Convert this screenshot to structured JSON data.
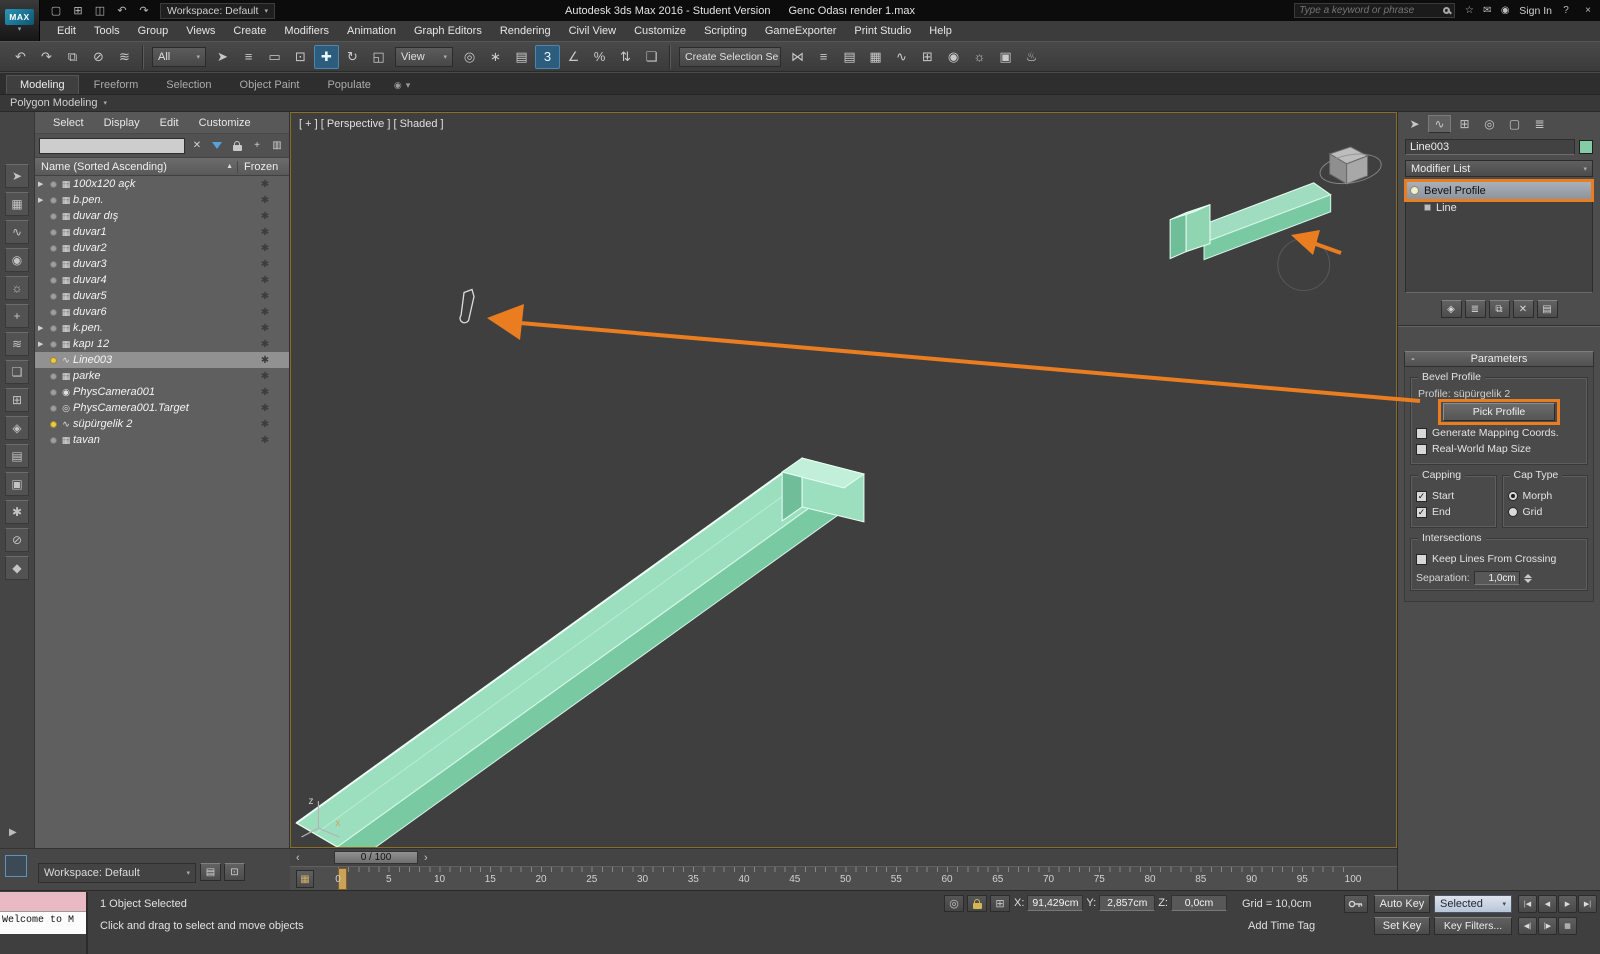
{
  "glyphs": {
    "arrow_down": "▾",
    "check": "✓",
    "minus": "-",
    "sort_asc": "▲",
    "slider_prev": "‹",
    "slider_next": "›",
    "expand": "▶"
  },
  "titlebar": {
    "app_icon": "MAX",
    "qat": [
      {
        "n": "new-scene-icon",
        "g": "▢"
      },
      {
        "n": "open-file-icon",
        "g": "⊞"
      },
      {
        "n": "save-file-icon",
        "g": "◫"
      },
      {
        "n": "undo-icon",
        "g": "↶"
      },
      {
        "n": "redo-icon",
        "g": "↷"
      }
    ],
    "workspace": "Workspace: Default",
    "title": "Autodesk 3ds Max 2016 - Student Version",
    "filename": "Genc Odası render 1.max",
    "search_placeholder": "Type a keyword or phrase",
    "info_icons": [
      {
        "n": "favorites-star-icon",
        "g": "☆"
      },
      {
        "n": "communication-icon",
        "g": "✉"
      },
      {
        "n": "user-icon",
        "g": "◉"
      }
    ],
    "sign_in": "Sign In",
    "help_icon": "?",
    "close_icon": "×"
  },
  "menubar": {
    "items": [
      "Edit",
      "Tools",
      "Group",
      "Views",
      "Create",
      "Modifiers",
      "Animation",
      "Graph Editors",
      "Rendering",
      "Civil View",
      "Customize",
      "Scripting",
      "GameExporter",
      "Print Studio",
      "Help"
    ]
  },
  "toolbar": {
    "seg1": [
      {
        "n": "undo-icon",
        "g": "↶"
      },
      {
        "n": "redo-icon",
        "g": "↷"
      },
      {
        "n": "select-and-link-icon",
        "g": "⧉"
      },
      {
        "n": "unlink-selection-icon",
        "g": "⊘"
      },
      {
        "n": "bind-to-space-warp-icon",
        "g": "≋"
      }
    ],
    "filter_value": "All",
    "seg2": [
      {
        "n": "select-object-icon",
        "g": "➤"
      },
      {
        "n": "select-by-name-icon",
        "g": "≡"
      },
      {
        "n": "rectangular-selection-icon",
        "g": "▭"
      },
      {
        "n": "window-crossing-icon",
        "g": "⊡"
      },
      {
        "n": "select-and-move-icon",
        "g": "✚",
        "cls": "active"
      },
      {
        "n": "select-and-rotate-icon",
        "g": "↻"
      },
      {
        "n": "select-and-scale-icon",
        "g": "◱"
      }
    ],
    "view_value": "View",
    "seg3": [
      {
        "n": "use-center-icon",
        "g": "◎"
      },
      {
        "n": "select-and-manipulate-icon",
        "g": "∗"
      },
      {
        "n": "keyboard-override-icon",
        "g": "▤"
      },
      {
        "n": "snaps-toggle-icon",
        "g": "3",
        "cls": "active"
      },
      {
        "n": "angle-snap-icon",
        "g": "∠"
      },
      {
        "n": "percent-snap-icon",
        "g": "%"
      },
      {
        "n": "spinner-snap-icon",
        "g": "⇅"
      },
      {
        "n": "edit-named-selections-icon",
        "g": "❏"
      }
    ],
    "selset_value": "Create Selection Se",
    "seg4": [
      {
        "n": "mirror-icon",
        "g": "⋈"
      },
      {
        "n": "align-icon",
        "g": "≡"
      },
      {
        "n": "layer-manager-icon",
        "g": "▤"
      },
      {
        "n": "ribbon-toggle-icon",
        "g": "▦"
      },
      {
        "n": "curve-editor-icon",
        "g": "∿"
      },
      {
        "n": "schematic-view-icon",
        "g": "⊞"
      },
      {
        "n": "material-editor-icon",
        "g": "◉"
      },
      {
        "n": "render-setup-icon",
        "g": "☼"
      },
      {
        "n": "rendered-frame-icon",
        "g": "▣"
      },
      {
        "n": "render-production-icon",
        "g": "♨"
      }
    ]
  },
  "ribbon": {
    "tabs": [
      {
        "label": "Modeling",
        "cls": "active"
      },
      {
        "label": "Freeform"
      },
      {
        "label": "Selection"
      },
      {
        "label": "Object Paint"
      },
      {
        "label": "Populate"
      }
    ],
    "extra": [
      {
        "n": "ribbon-options-icon",
        "g": "◉"
      },
      {
        "n": "ribbon-collapse-icon",
        "g": "▾"
      }
    ],
    "subtab": "Polygon Modeling"
  },
  "explorer": {
    "left_icons": [
      {
        "n": "select-filter-icon",
        "g": "➤"
      },
      {
        "n": "show-geometry-icon",
        "g": "▦"
      },
      {
        "n": "show-shapes-icon",
        "g": "∿"
      },
      {
        "n": "show-cameras-icon",
        "g": "◉"
      },
      {
        "n": "show-lights-icon",
        "g": "☼"
      },
      {
        "n": "show-helpers-icon",
        "g": "+"
      },
      {
        "n": "show-spacewarps-icon",
        "g": "≋"
      },
      {
        "n": "show-groups-icon",
        "g": "❏"
      },
      {
        "n": "show-xrefs-icon",
        "g": "⊞"
      },
      {
        "n": "show-materials-icon",
        "g": "◈"
      },
      {
        "n": "show-containers-icon",
        "g": "▤"
      },
      {
        "n": "show-bones-icon",
        "g": "▣"
      },
      {
        "n": "show-frozen-icon",
        "g": "✱"
      },
      {
        "n": "show-hidden-icon",
        "g": "⊘"
      },
      {
        "n": "pin-explorer-icon",
        "g": "◆"
      }
    ],
    "menus": [
      "Select",
      "Display",
      "Edit",
      "Customize"
    ],
    "header_name": "Name (Sorted Ascending)",
    "header_frozen": "Frozen",
    "items": [
      {
        "expand": "▶",
        "icon": "▦",
        "label": "100x120 açk",
        "frozen": "✱"
      },
      {
        "expand": "▶",
        "icon": "▦",
        "label": "b.pen.",
        "frozen": "✱"
      },
      {
        "icon": "▦",
        "label": "duvar dış",
        "frozen": "✱"
      },
      {
        "icon": "▦",
        "label": "duvar1",
        "frozen": "✱"
      },
      {
        "icon": "▦",
        "label": "duvar2",
        "frozen": "✱"
      },
      {
        "icon": "▦",
        "label": "duvar3",
        "frozen": "✱"
      },
      {
        "icon": "▦",
        "label": "duvar4",
        "frozen": "✱"
      },
      {
        "icon": "▦",
        "label": "duvar5",
        "frozen": "✱"
      },
      {
        "icon": "▦",
        "label": "duvar6",
        "frozen": "✱"
      },
      {
        "expand": "▶",
        "icon": "▦",
        "label": "k.pen.",
        "frozen": "✱"
      },
      {
        "expand": "▶",
        "icon": "▦",
        "label": "kapı 12",
        "frozen": "✱"
      },
      {
        "icon": "∿",
        "label": "Line003",
        "frozen": "✱",
        "cls": "selected bulb"
      },
      {
        "icon": "▦",
        "label": "parke",
        "frozen": "✱"
      },
      {
        "icon": "◉",
        "label": "PhysCamera001",
        "frozen": "✱"
      },
      {
        "icon": "◎",
        "label": "PhysCamera001.Target",
        "frozen": "✱"
      },
      {
        "icon": "∿",
        "label": "süpürgelik 2",
        "frozen": "✱",
        "cls": "bulb"
      },
      {
        "icon": "▦",
        "label": "tavan",
        "frozen": "✱"
      }
    ]
  },
  "viewport": {
    "label": "[ + ] [ Perspective ] [ Shaded ]",
    "axis_x": "x",
    "axis_z": "z"
  },
  "cpanel": {
    "tabs": [
      {
        "n": "create-tab-icon",
        "g": "➤"
      },
      {
        "n": "modify-tab-icon",
        "g": "∿",
        "cls": "active"
      },
      {
        "n": "hierarchy-tab-icon",
        "g": "⊞"
      },
      {
        "n": "motion-tab-icon",
        "g": "◎"
      },
      {
        "n": "display-tab-icon",
        "g": "▢"
      },
      {
        "n": "utilities-tab-icon",
        "g": "≣"
      }
    ],
    "object_name": "Line003",
    "modifier_list": "Modifier List",
    "stack": [
      {
        "label": "Bevel Profile",
        "cls": "selected annotated"
      },
      {
        "label": "Line",
        "cls": "child"
      }
    ],
    "stack_tools": [
      {
        "n": "pin-stack-icon",
        "g": "◈"
      },
      {
        "n": "show-end-result-icon",
        "g": "≣"
      },
      {
        "n": "make-unique-icon",
        "g": "⧉"
      },
      {
        "n": "remove-modifier-icon",
        "g": "✕"
      },
      {
        "n": "configure-modifier-sets-icon",
        "g": "▤"
      }
    ],
    "params": {
      "rollout": "Parameters",
      "group": "Bevel Profile",
      "profile": "Profile: süpürgelik 2",
      "pick_profile": "Pick Profile",
      "gen_map": "Generate Mapping Coords.",
      "real_world": "Real-World Map Size",
      "capping": "Capping",
      "cap_type": "Cap Type",
      "start": "Start",
      "end": "End",
      "morph": "Morph",
      "grid": "Grid",
      "intersections": "Intersections",
      "keep_lines": "Keep Lines From Crossing",
      "separation": "Separation:",
      "separation_value": "1,0cm"
    }
  },
  "timeline": {
    "frame": "0 / 100",
    "ticks": [
      "0",
      "5",
      "10",
      "15",
      "20",
      "25",
      "30",
      "35",
      "40",
      "45",
      "50",
      "55",
      "60",
      "65",
      "70",
      "75",
      "80",
      "85",
      "90",
      "95",
      "100"
    ]
  },
  "statusbar": {
    "listener": "Welcome to M",
    "selection": "1 Object Selected",
    "prompt": "Click and drag to select and move objects",
    "icons": [
      {
        "n": "isolate-selection-icon",
        "g": "◎"
      },
      {
        "n": "absolute-mode-toggle-icon",
        "g": "⊞"
      }
    ],
    "x_label": "X:",
    "x_value": "91,429cm",
    "y_label": "Y:",
    "y_value": "2,857cm",
    "z_label": "Z:",
    "z_value": "0,0cm",
    "grid_label": "Grid = 10,0cm",
    "add_time_tag": "Add Time Tag",
    "auto_key": "Auto Key",
    "set_key": "Set Key",
    "selected_set": "Selected",
    "key_filters": "Key Filters...",
    "playback1": [
      {
        "n": "go-to-start-icon",
        "g": "|◀"
      },
      {
        "n": "previous-frame-icon",
        "g": "◀"
      },
      {
        "n": "play-animation-icon",
        "g": "▶"
      },
      {
        "n": "go-to-end-icon",
        "g": "▶|"
      }
    ],
    "playback2": [
      {
        "n": "previous-key-icon",
        "g": "◀|"
      },
      {
        "n": "next-key-icon",
        "g": "|▶"
      },
      {
        "n": "time-config-icon",
        "g": "▦"
      }
    ]
  },
  "bottombar": {
    "workspace": "Workspace: Default",
    "icons": [
      {
        "n": "layers-icon",
        "g": "▤"
      },
      {
        "n": "viewport-layouts-icon",
        "g": "⊡"
      }
    ]
  }
}
